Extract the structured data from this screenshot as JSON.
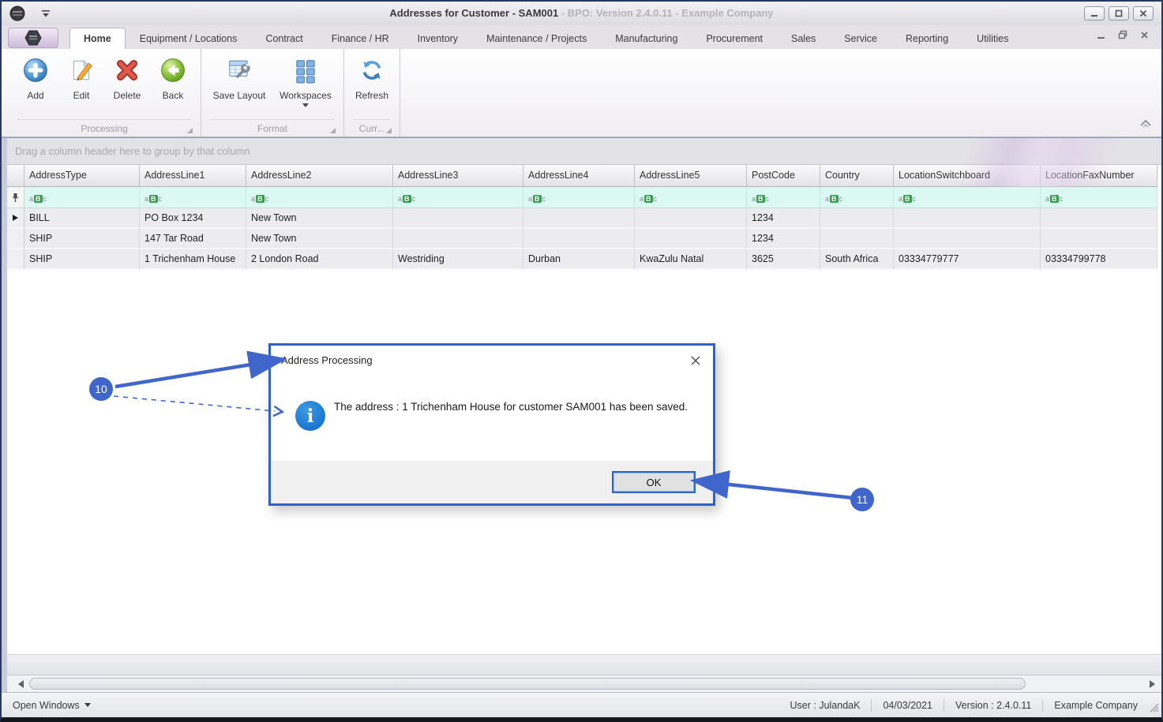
{
  "window": {
    "title": "Addresses for Customer - SAM001",
    "title_suffix": " - BPO: Version 2.4.0.11 - Example Company"
  },
  "ribbon": {
    "tabs": [
      "Home",
      "Equipment / Locations",
      "Contract",
      "Finance / HR",
      "Inventory",
      "Maintenance / Projects",
      "Manufacturing",
      "Procurement",
      "Sales",
      "Service",
      "Reporting",
      "Utilities"
    ],
    "active_tab": "Home",
    "groups": [
      {
        "label": "Processing",
        "buttons": [
          "Add",
          "Edit",
          "Delete",
          "Back"
        ]
      },
      {
        "label": "Format",
        "buttons": [
          "Save Layout",
          "Workspaces"
        ]
      },
      {
        "label": "Curr...",
        "buttons": [
          "Refresh"
        ]
      }
    ]
  },
  "grid": {
    "group_hint": "Drag a column header here to group by that column",
    "columns": [
      "AddressType",
      "AddressLine1",
      "AddressLine2",
      "AddressLine3",
      "AddressLine4",
      "AddressLine5",
      "PostCode",
      "Country",
      "LocationSwitchboard",
      "LocationFaxNumber"
    ],
    "filter_glyph": "aBc",
    "rows": [
      [
        "BILL",
        "PO Box 1234",
        "New Town",
        "",
        "",
        "",
        "1234",
        "",
        "",
        ""
      ],
      [
        "SHIP",
        "147 Tar Road",
        "New Town",
        "",
        "",
        "",
        "1234",
        "",
        "",
        ""
      ],
      [
        "SHIP",
        "1 Trichenham House",
        "2 London Road",
        "Westriding",
        "Durban",
        "KwaZulu Natal",
        "3625",
        "South Africa",
        "03334779777",
        "03334799778"
      ]
    ]
  },
  "dialog": {
    "title": "Address Processing",
    "message": "The address : 1 Trichenham House for customer SAM001 has been saved.",
    "ok_label": "OK"
  },
  "annotations": {
    "callout_10": "10",
    "callout_11": "11",
    "accent_color": "#4066cc"
  },
  "statusbar": {
    "open_windows": "Open Windows",
    "user": "User : JulandaK",
    "date": "04/03/2021",
    "version": "Version : 2.4.0.11",
    "company": "Example Company"
  }
}
